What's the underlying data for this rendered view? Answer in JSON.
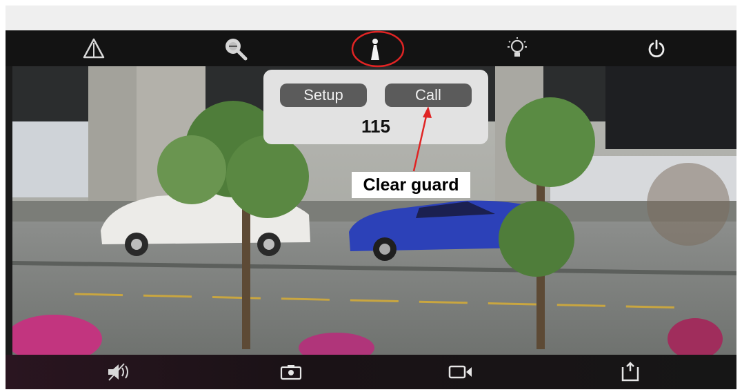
{
  "toolbar": {
    "top_icons": [
      "warning-icon",
      "search-zoom-icon",
      "guard-icon",
      "light-bulb-icon",
      "power-icon"
    ],
    "bottom_icons": [
      "mute-speaker-icon",
      "snapshot-icon",
      "record-video-icon",
      "exit-icon"
    ]
  },
  "popup": {
    "setup_label": "Setup",
    "call_label": "Call",
    "number": "115"
  },
  "annotation": {
    "text": "Clear guard",
    "color": "#e02424"
  }
}
